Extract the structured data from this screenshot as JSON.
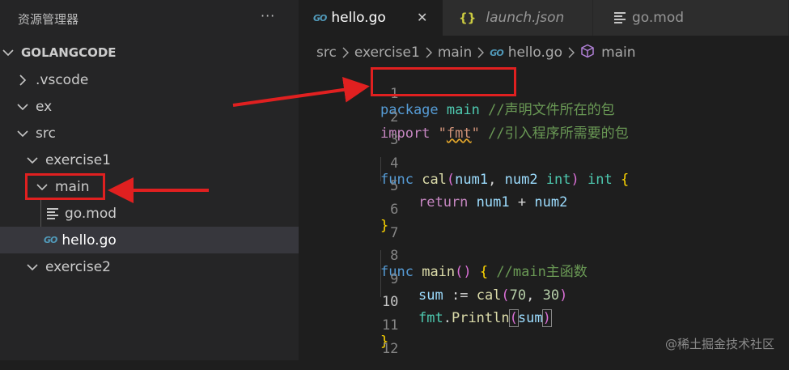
{
  "explorer": {
    "title": "资源管理器",
    "more": "···",
    "root": "GOLANGCODE",
    "items": [
      {
        "label": ".vscode",
        "type": "folder",
        "expanded": false
      },
      {
        "label": "ex",
        "type": "folder",
        "expanded": true
      },
      {
        "label": "src",
        "type": "folder",
        "expanded": true
      },
      {
        "label": "exercise1",
        "type": "folder",
        "expanded": true
      },
      {
        "label": "main",
        "type": "folder",
        "expanded": true
      },
      {
        "label": "go.mod",
        "type": "file"
      },
      {
        "label": "hello.go",
        "type": "file",
        "selected": true
      },
      {
        "label": "exercise2",
        "type": "folder",
        "expanded": true
      }
    ],
    "go_icon_text": "GO"
  },
  "tabs": [
    {
      "label": "hello.go",
      "icon": "go-icon",
      "icon_text": "GO",
      "active": true,
      "close": "✕"
    },
    {
      "label": "launch.json",
      "icon": "braces-icon",
      "icon_text": "{}",
      "active": false,
      "italic": true
    },
    {
      "label": "go.mod",
      "icon": "lines-icon",
      "active": false
    }
  ],
  "breadcrumb": [
    "src",
    "exercise1",
    "main",
    "hello.go",
    "main"
  ],
  "code": {
    "line_numbers": [
      "1",
      "2",
      "3",
      "4",
      "5",
      "6",
      "7",
      "8",
      "9",
      "10",
      "11",
      "12"
    ],
    "current_line": "10",
    "l1": {
      "kw": "package",
      "name": "main",
      "comment": "//声明文件所在的包"
    },
    "l2": {
      "kw": "import",
      "q1": "\"",
      "pkg": "fmt",
      "q2": "\"",
      "comment": "//引入程序所需要的包"
    },
    "l4": {
      "kw": "func",
      "fn": "cal",
      "p1": "num1",
      "p2": "num2",
      "ty1": "int",
      "ty2": "int"
    },
    "l5": {
      "kw": "return",
      "a": "num1",
      "op": "+",
      "b": "num2"
    },
    "l8": {
      "kw": "func",
      "fn": "main",
      "comment": "//main主函数"
    },
    "l9": {
      "v": "sum",
      "op": ":=",
      "fn": "cal",
      "n1": "70",
      "n2": "30"
    },
    "l10": {
      "pkg": "fmt",
      "fn": "Println",
      "arg": "sum"
    }
  },
  "watermark": "@稀土掘金技术社区",
  "colors": {
    "annotation": "#e02020",
    "keyword": "#569cd6",
    "comment": "#6a9955"
  }
}
